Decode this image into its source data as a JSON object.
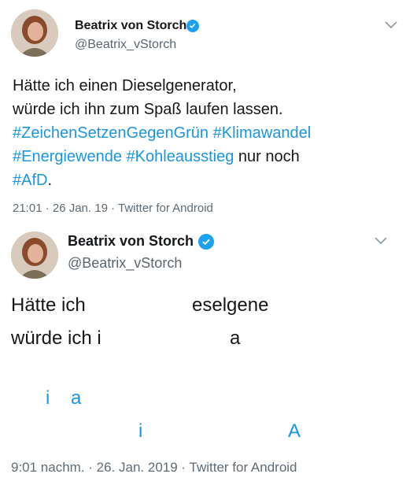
{
  "tweet1": {
    "name": "Beatrix von Storch",
    "handle": "@Beatrix_vStorch",
    "line1": "Hätte ich einen Dieselgenerator,",
    "line2": "würde ich ihn zum Spaß laufen lassen.",
    "hashtag1": "#ZeichenSetzenGegenGrün",
    "hashtag2": "#Klimawandel",
    "hashtag3": "#Energiewende",
    "hashtag4": "#Kohleausstieg",
    "text_after": "nur noch",
    "hashtag5": "#AfD",
    "period": ".",
    "meta": "21:01 · 26 Jan. 19 · Twitter for Android"
  },
  "tweet2": {
    "name": "Beatrix von Storch",
    "handle": "@Beatrix_vStorch",
    "frag_1": "Hätte ich",
    "frag_2": "eselgene",
    "frag_3": "würde ich i",
    "frag_4": "a",
    "frag_5": "i",
    "frag_6": "a",
    "frag_7": "i",
    "frag_8": "A",
    "meta": "9:01 nachm. · 26. Jan. 2019 · Twitter for Android"
  },
  "icons": {
    "verified": "verified-badge-icon",
    "more": "chevron-down-icon"
  },
  "colors": {
    "hashtag": "#1b95e0",
    "verified": "#1da1f2",
    "meta": "#5f6b75"
  }
}
